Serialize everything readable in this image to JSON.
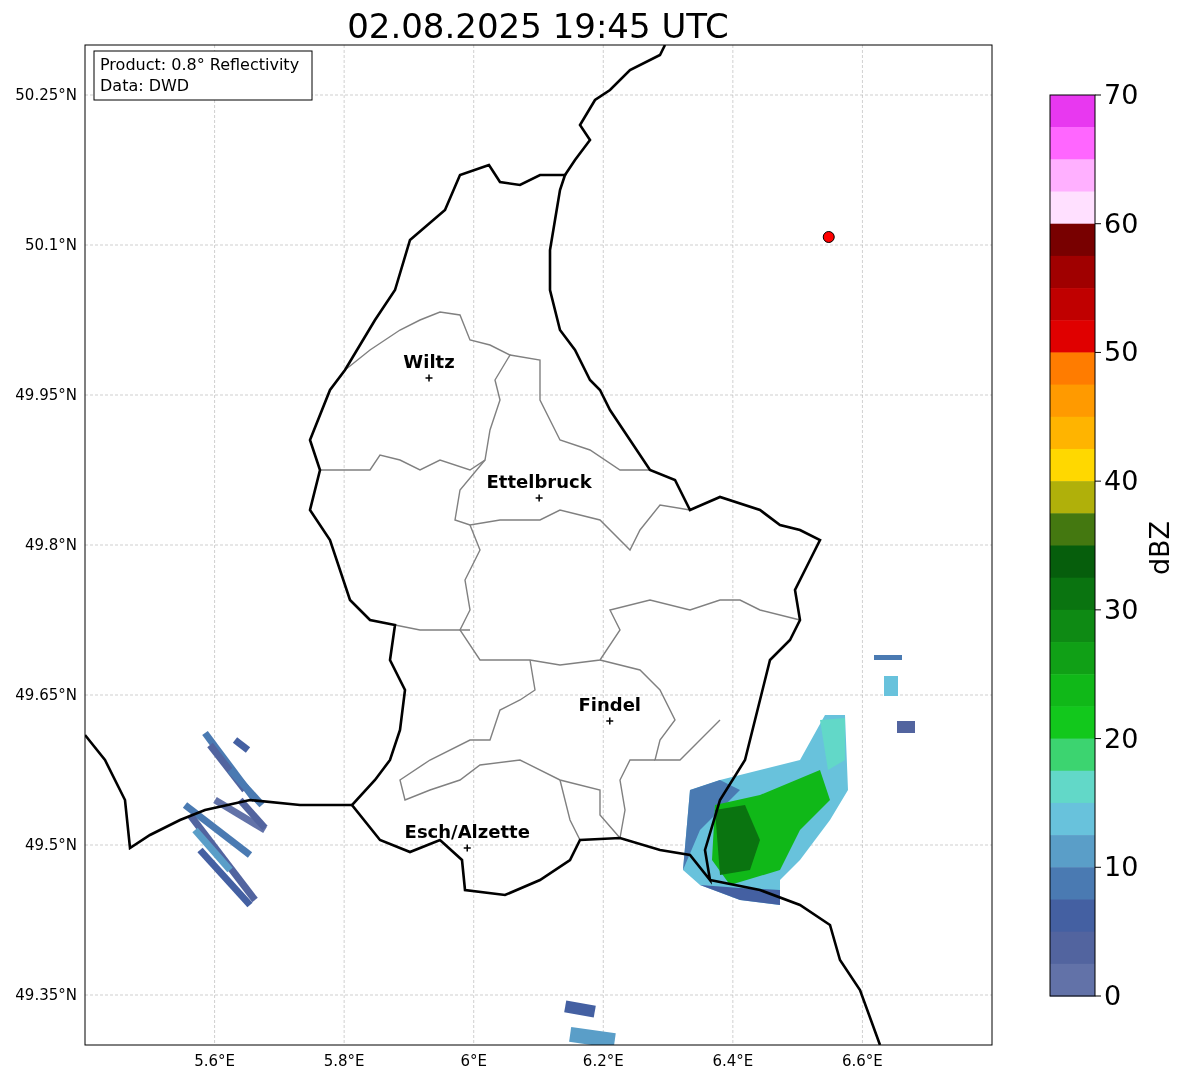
{
  "title": "02.08.2025 19:45 UTC",
  "info_box": {
    "lines": [
      "Product: 0.8° Reflectivity",
      "Data: DWD"
    ]
  },
  "map": {
    "lat_labels": [
      "50.25°N",
      "50.1°N",
      "49.95°N",
      "49.8°N",
      "49.65°N",
      "49.5°N",
      "49.35°N"
    ],
    "lon_labels": [
      "5.6°E",
      "5.8°E",
      "6°E",
      "6.2°E",
      "6.4°E",
      "6.6°E"
    ],
    "cities": [
      {
        "name": "Wiltz"
      },
      {
        "name": "Ettelbruck"
      },
      {
        "name": "Findel"
      },
      {
        "name": "Esch/Alzette"
      }
    ]
  },
  "colorbar": {
    "label": "dBZ",
    "ticks": [
      "70",
      "60",
      "50",
      "40",
      "30",
      "20",
      "10",
      "0"
    ],
    "bands": [
      {
        "color": "#e838f0"
      },
      {
        "color": "#ff66ff"
      },
      {
        "color": "#ffb0ff"
      },
      {
        "color": "#ffe0ff"
      },
      {
        "color": "#780000"
      },
      {
        "color": "#a00000"
      },
      {
        "color": "#c00000"
      },
      {
        "color": "#e00000"
      },
      {
        "color": "#ff7c00"
      },
      {
        "color": "#ff9a00"
      },
      {
        "color": "#ffb400"
      },
      {
        "color": "#ffd800"
      },
      {
        "color": "#b0b00a"
      },
      {
        "color": "#447810"
      },
      {
        "color": "#065e0c"
      },
      {
        "color": "#0a7410"
      },
      {
        "color": "#0e8a14"
      },
      {
        "color": "#10a016"
      },
      {
        "color": "#10b818"
      },
      {
        "color": "#12c81c"
      },
      {
        "color": "#3cd470"
      },
      {
        "color": "#62d8c8"
      },
      {
        "color": "#68c2dc"
      },
      {
        "color": "#5a9ec8"
      },
      {
        "color": "#4a7ab2"
      },
      {
        "color": "#4460a2"
      },
      {
        "color": "#52649f"
      },
      {
        "color": "#6272a8"
      }
    ]
  }
}
